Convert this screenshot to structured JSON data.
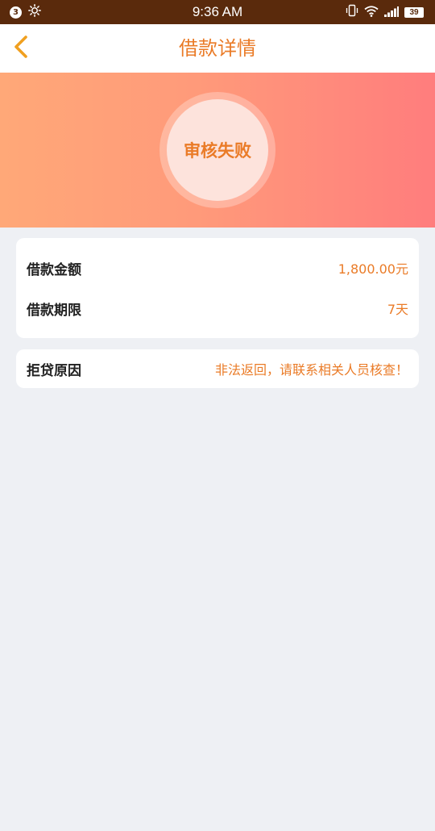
{
  "status_bar": {
    "notification_count": "3",
    "time": "9:36 AM",
    "battery": "39"
  },
  "nav": {
    "title": "借款详情"
  },
  "banner": {
    "status": "审核失败"
  },
  "loan_info": {
    "amount_label": "借款金额",
    "amount_value": "1,800.00元",
    "term_label": "借款期限",
    "term_value": "7天"
  },
  "rejection": {
    "label": "拒贷原因",
    "reason": "非法返回，请联系相关人员核查！"
  },
  "colors": {
    "accent": "#ea7b27",
    "status_bar": "#5a2a0c",
    "banner_start": "#ffa878",
    "banner_end": "#ff7d7d",
    "background": "#eef0f4"
  }
}
